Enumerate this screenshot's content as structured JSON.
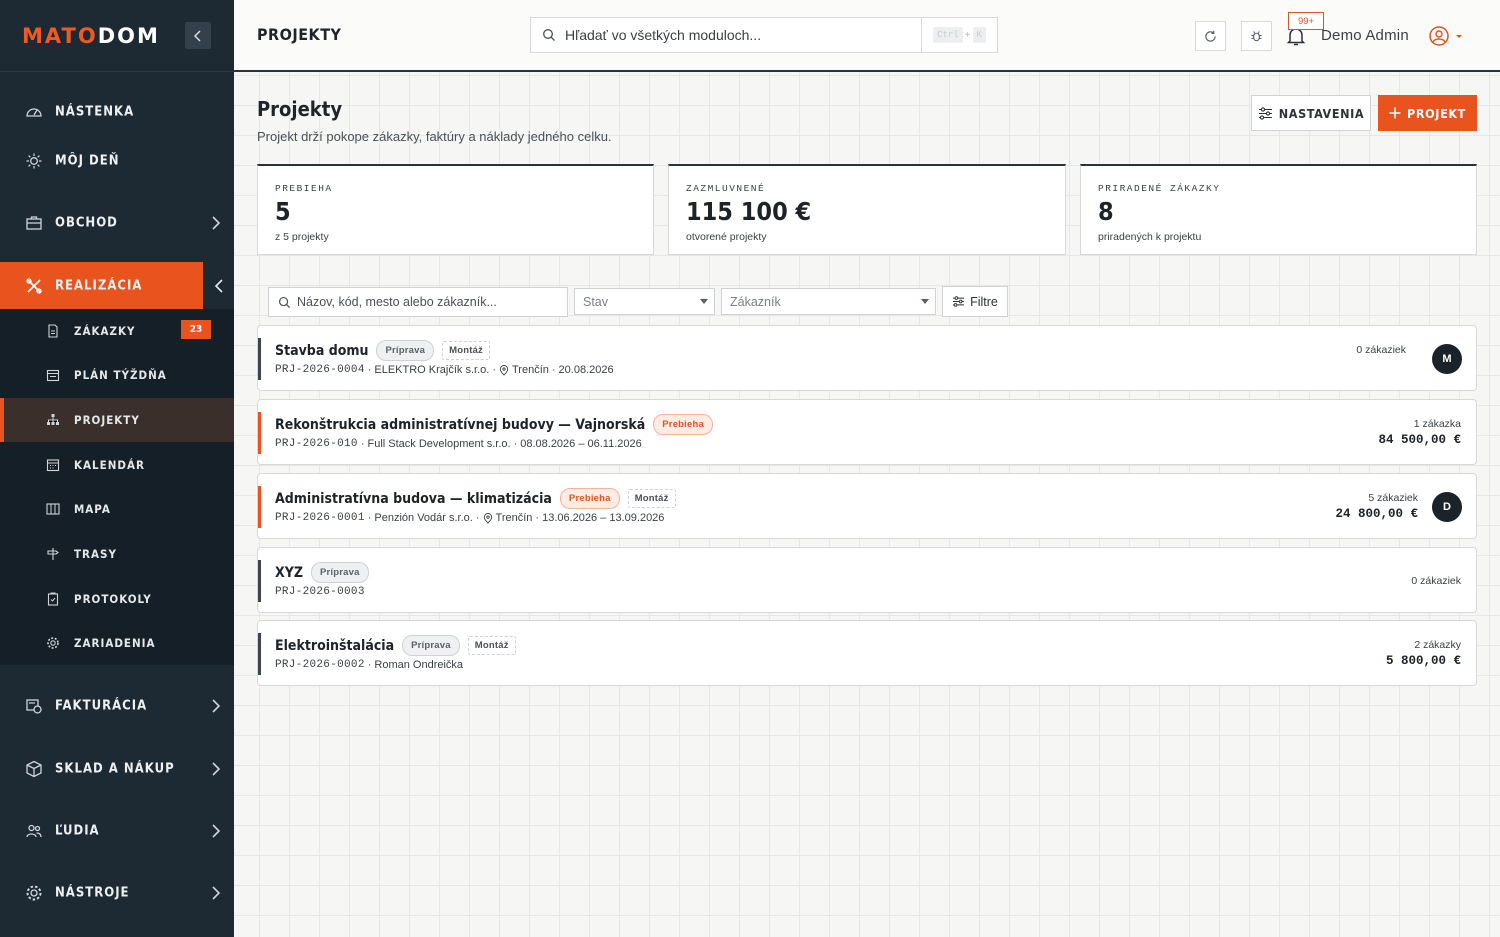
{
  "app": {
    "logo_a": "MATO",
    "logo_b": "DOM",
    "page_header": "PROJEKTY"
  },
  "search": {
    "placeholder": "Hľadať vo všetkých moduloch...",
    "kbd1": "Ctrl",
    "kbd_plus": "+",
    "kbd2": "K"
  },
  "notifications": {
    "badge": "99+"
  },
  "user": {
    "name": "Demo Admin"
  },
  "sidebar": {
    "items": [
      {
        "label": "NÁSTENKA",
        "icon": "gauge-icon"
      },
      {
        "label": "MÔJ DEŇ",
        "icon": "sun-icon"
      },
      {
        "label": "OBCHOD",
        "icon": "briefcase-icon"
      },
      {
        "label": "REALIZÁCIA",
        "icon": "tools-icon"
      },
      {
        "label": "FAKTURÁCIA",
        "icon": "invoice-icon"
      },
      {
        "label": "SKLAD A NÁKUP",
        "icon": "box-icon"
      },
      {
        "label": "ĽUDIA",
        "icon": "people-icon"
      },
      {
        "label": "NÁSTROJE",
        "icon": "cog-icon"
      }
    ],
    "sub_items": [
      {
        "label": "ZÁKAZKY",
        "icon": "document-icon",
        "badge": "23"
      },
      {
        "label": "PLÁN TÝŽDŇA",
        "icon": "calendar-week-icon"
      },
      {
        "label": "PROJEKTY",
        "icon": "hierarchy-icon"
      },
      {
        "label": "KALENDÁR",
        "icon": "calendar-icon"
      },
      {
        "label": "MAPA",
        "icon": "map-icon"
      },
      {
        "label": "TRASY",
        "icon": "signpost-icon"
      },
      {
        "label": "PROTOKOLY",
        "icon": "clipboard-icon"
      },
      {
        "label": "ZARIADENIA",
        "icon": "gear-icon"
      }
    ]
  },
  "page": {
    "title": "Projekty",
    "subtitle": "Projekt drží pokope zákazky, faktúry a náklady jedného celku.",
    "settings_label": "NASTAVENIA",
    "new_label": "PROJEKT"
  },
  "stats": [
    {
      "label": "PREBIEHA",
      "value": "5",
      "sub": "z 5 projekty"
    },
    {
      "label": "ZAZMLUVNENÉ",
      "value": "115 100 €",
      "sub": "otvorené projekty"
    },
    {
      "label": "PRIRADENÉ ZÁKAZKY",
      "value": "8",
      "sub": "priradených k projektu"
    }
  ],
  "filters": {
    "search_placeholder": "Názov, kód, mesto alebo zákazník...",
    "status_placeholder": "Stav",
    "customer_placeholder": "Zákazník",
    "filter_label": "Filtre"
  },
  "projects": [
    {
      "name": "Stavba domu",
      "status": "Príprava",
      "tag": "Montáž",
      "code": "PRJ-2026-0004",
      "customer": "ELEKTRO Krajčík s.r.o.",
      "city": "Trenčín",
      "dates": "20.08.2026",
      "orders": "0 zákaziek",
      "amount": "",
      "avatar": "M",
      "accent": "#3a4550"
    },
    {
      "name": "Rekonštrukcia administratívnej budovy — Vajnorská",
      "status": "Prebieha",
      "tag": "",
      "code": "PRJ-2026-010",
      "customer": "Full Stack Development s.r.o.",
      "city": "",
      "dates": "08.08.2026 – 06.11.2026",
      "orders": "1 zákazka",
      "amount": "84 500,00 €",
      "avatar": "",
      "accent": "#e8531e"
    },
    {
      "name": "Administratívna budova — klimatizácia",
      "status": "Prebieha",
      "tag": "Montáž",
      "code": "PRJ-2026-0001",
      "customer": "Penzión Vodár s.r.o.",
      "city": "Trenčín",
      "dates": "13.06.2026 – 13.09.2026",
      "orders": "5 zákaziek",
      "amount": "24 800,00 €",
      "avatar": "D",
      "accent": "#e8531e"
    },
    {
      "name": "XYZ",
      "status": "Príprava",
      "tag": "",
      "code": "PRJ-2026-0003",
      "customer": "",
      "city": "",
      "dates": "",
      "orders": "0 zákaziek",
      "amount": "",
      "avatar": "",
      "accent": "#3a4550"
    },
    {
      "name": "Elektroinštalácia",
      "status": "Príprava",
      "tag": "Montáž",
      "code": "PRJ-2026-0002",
      "customer": "Roman Ondreička",
      "city": "",
      "dates": "",
      "orders": "2 zákazky",
      "amount": "5 800,00 €",
      "avatar": "",
      "accent": "#3a4550"
    }
  ]
}
